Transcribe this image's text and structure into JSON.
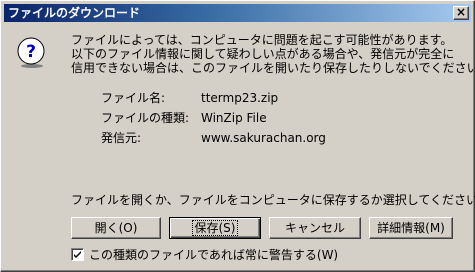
{
  "window": {
    "title": "ファイルのダウンロード",
    "close_glyph": "×"
  },
  "message": {
    "line1": "ファイルによっては、コンピュータに問題を起こす可能性があります。",
    "line2": "以下のファイル情報に関して疑わしい点がある場合や、発信元が完全に",
    "line3": "信用できない場合は、このファイルを開いたり保存したりしないでください。"
  },
  "file_info": {
    "name_label": "ファイル名:",
    "name_value": "ttermp23.zip",
    "type_label": "ファイルの種類:",
    "type_value": "WinZip File",
    "source_label": "発信元:",
    "source_value": "www.sakurachan.org"
  },
  "prompt": "ファイルを開くか、ファイルをコンピュータに保存するか選択してください。",
  "buttons": {
    "open": "開く(O)",
    "save": "保存(S)",
    "cancel": "キャンセル",
    "details": "詳細情報(M)"
  },
  "always_warn": {
    "label": "この種類のファイルであれば常に警告する(W)",
    "checked": true
  },
  "icons": {
    "dialog_icon": "question-icon",
    "checkbox_mark": "check-icon"
  }
}
